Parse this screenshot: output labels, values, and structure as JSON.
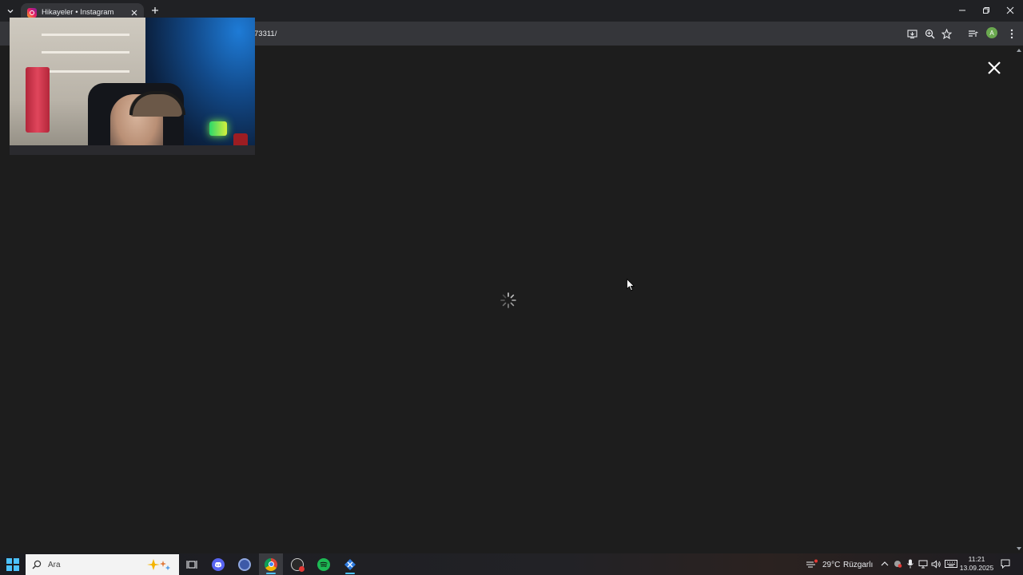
{
  "browser": {
    "tab": {
      "title": "Hikayeler • Instagram"
    },
    "address": {
      "url_visible": "73311/"
    },
    "profile_initial": "A"
  },
  "taskbar": {
    "search_placeholder": "Ara",
    "weather": {
      "temp": "29°C",
      "condition": "Rüzgarlı"
    },
    "clock": {
      "time": "11:21",
      "date": "13.09.2025"
    }
  },
  "colors": {
    "accent": "#4cc2ff",
    "page_bg": "#1d1d1d",
    "spotify": "#1db954",
    "discord": "#5865f2"
  }
}
